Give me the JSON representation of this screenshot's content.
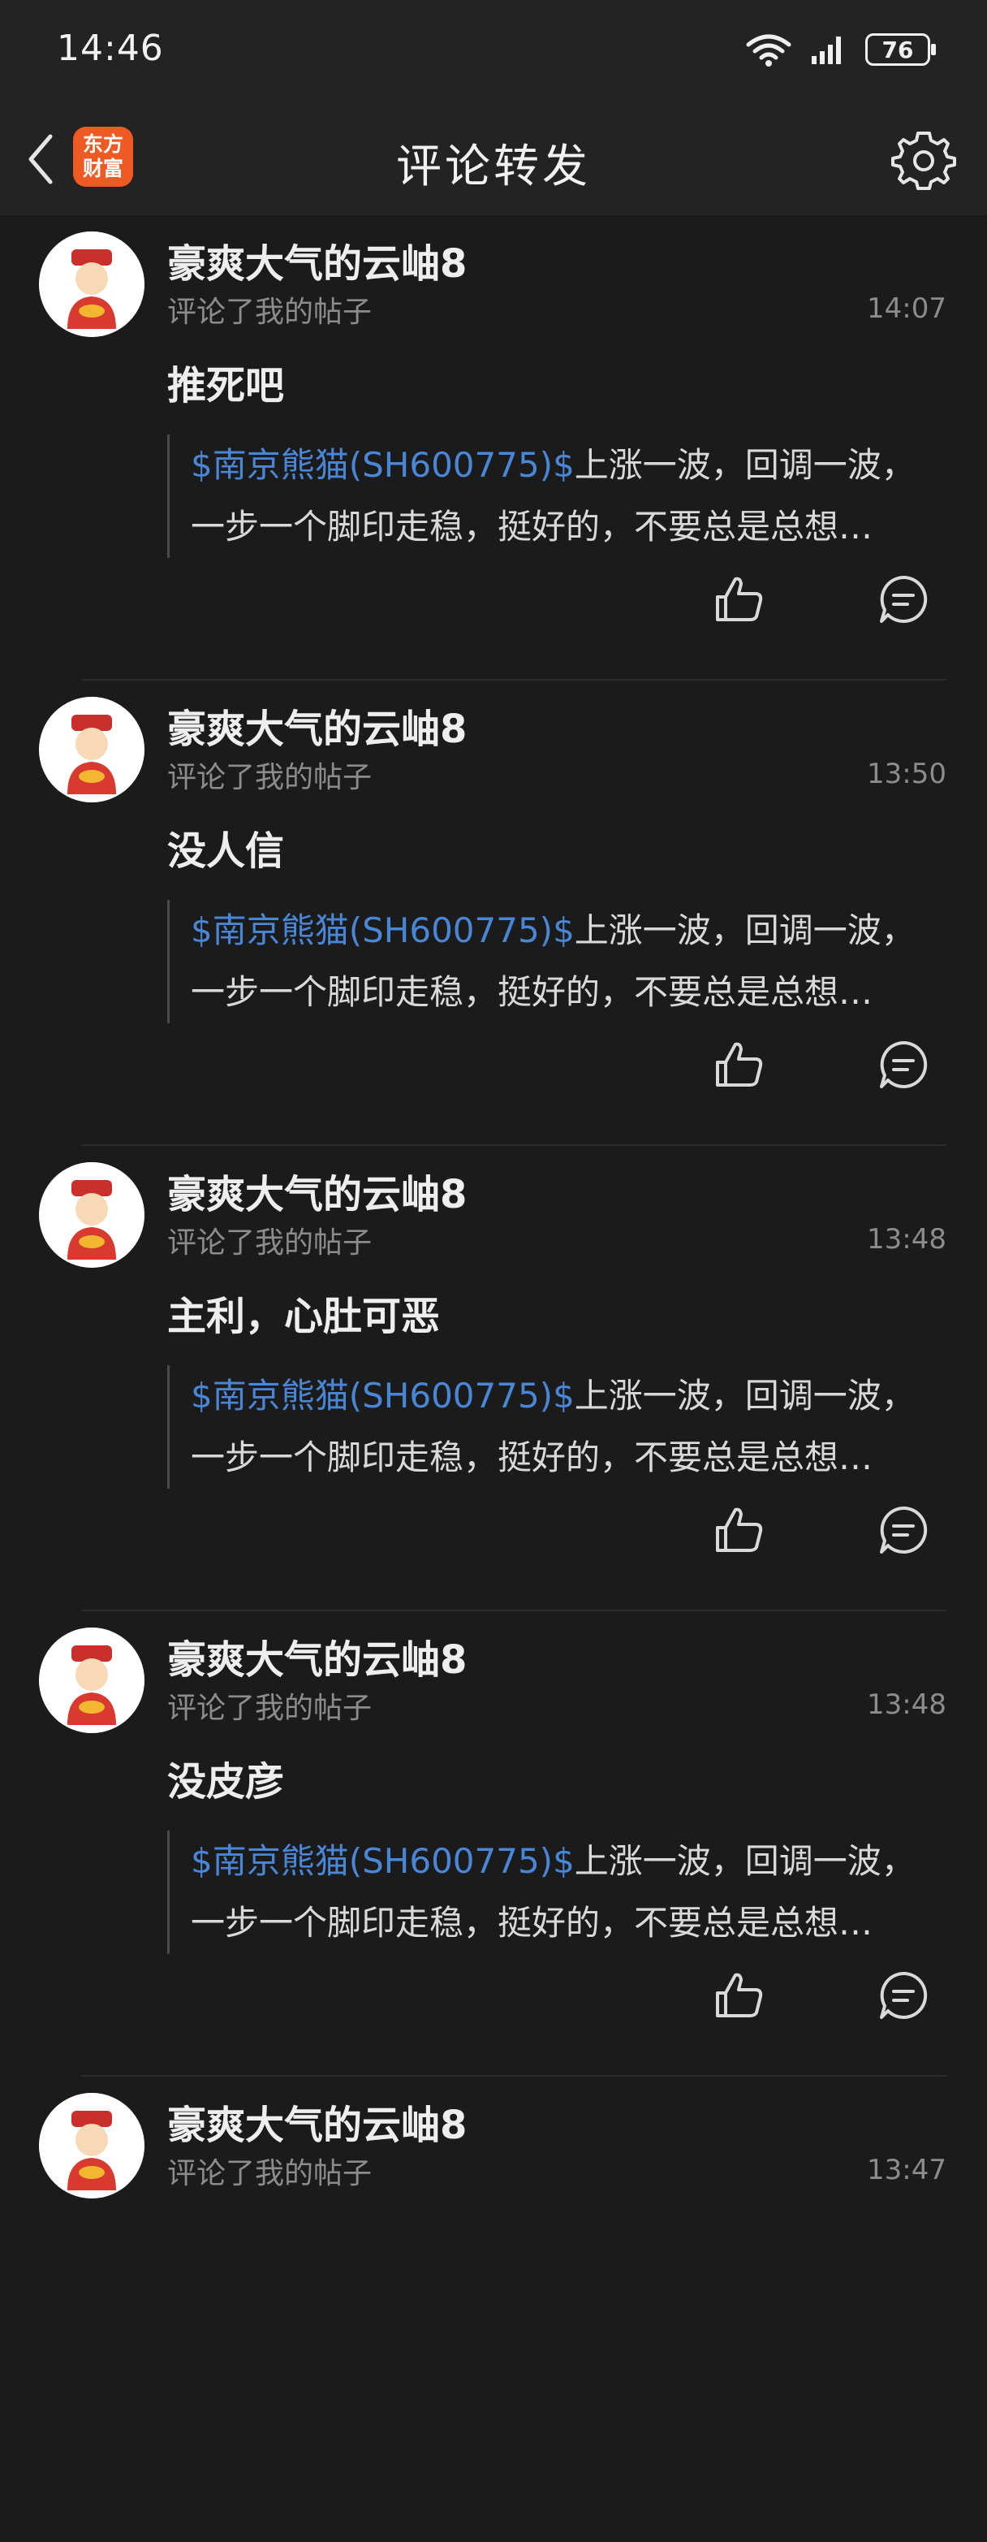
{
  "status_bar": {
    "time": "14:46",
    "battery": "76"
  },
  "nav": {
    "title": "评论转发",
    "logo_text": "东方财富"
  },
  "notifications": [
    {
      "user": "豪爽大气的云岫8",
      "action": "评论了我的帖子",
      "time": "14:07",
      "comment": "推死吧",
      "quote_stock": "$南京熊猫(SH600775)$",
      "quote_text_1": "上涨一波，回调一波，",
      "quote_text_2": "一步一个脚印走稳，挺好的，不要总是总想…"
    },
    {
      "user": "豪爽大气的云岫8",
      "action": "评论了我的帖子",
      "time": "13:50",
      "comment": "没人信",
      "quote_stock": "$南京熊猫(SH600775)$",
      "quote_text_1": "上涨一波，回调一波，",
      "quote_text_2": "一步一个脚印走稳，挺好的，不要总是总想…"
    },
    {
      "user": "豪爽大气的云岫8",
      "action": "评论了我的帖子",
      "time": "13:48",
      "comment": "主利，心肚可恶",
      "quote_stock": "$南京熊猫(SH600775)$",
      "quote_text_1": "上涨一波，回调一波，",
      "quote_text_2": "一步一个脚印走稳，挺好的，不要总是总想…"
    },
    {
      "user": "豪爽大气的云岫8",
      "action": "评论了我的帖子",
      "time": "13:48",
      "comment": "没皮彦",
      "quote_stock": "$南京熊猫(SH600775)$",
      "quote_text_1": "上涨一波，回调一波，",
      "quote_text_2": "一步一个脚印走稳，挺好的，不要总是总想…"
    },
    {
      "user": "豪爽大气的云岫8",
      "action": "评论了我的帖子",
      "time": "13:47",
      "comment": "",
      "quote_stock": "",
      "quote_text_1": "",
      "quote_text_2": ""
    }
  ],
  "colors": {
    "background": "#1b1b1b",
    "header": "#232323",
    "link": "#4a86d6",
    "logo": "#ee5a24"
  }
}
